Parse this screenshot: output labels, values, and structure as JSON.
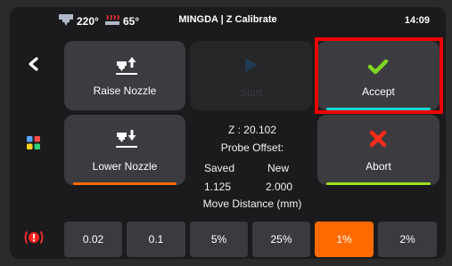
{
  "status_bar": {
    "extruder_icon": "hotend-icon",
    "extruder_temp": "220°",
    "bed_icon": "heated-bed-icon",
    "bed_temp": "65°",
    "title": "MINGDA  | Z Calibrate",
    "time": "14:09"
  },
  "sidebar": {
    "back_icon": "back-chevron-icon",
    "menu_icon": "app-grid-icon",
    "emergency_icon": "emergency-stop-icon"
  },
  "buttons": {
    "raise": {
      "label": "Raise Nozzle",
      "icon": "raise-nozzle-icon"
    },
    "start": {
      "label": "Start",
      "icon": "play-icon",
      "enabled": false
    },
    "accept": {
      "label": "Accept",
      "icon": "check-icon"
    },
    "lower": {
      "label": "Lower Nozzle",
      "icon": "lower-nozzle-icon"
    },
    "abort": {
      "label": "Abort",
      "icon": "cross-icon"
    }
  },
  "info": {
    "z": "Z : 20.102",
    "probe_offset_label": "Probe Offset:",
    "saved_label": "Saved",
    "new_label": "New",
    "saved_value": "1.125",
    "new_value": "2.000",
    "move_distance_label": "Move Distance (mm)"
  },
  "move_distance_options": [
    "0.02",
    "0.1",
    "5%",
    "25%",
    "1%",
    "2%"
  ],
  "selected_distance": "1%",
  "colors": {
    "accept_accent": "#1ed4d4",
    "check": "#7ed321",
    "lower_accent": "#ff6a00",
    "abort_accent": "#9be21f",
    "abort_cross": "#ff2a1a",
    "selected": "#ff6a00",
    "highlight": "#f00000"
  }
}
